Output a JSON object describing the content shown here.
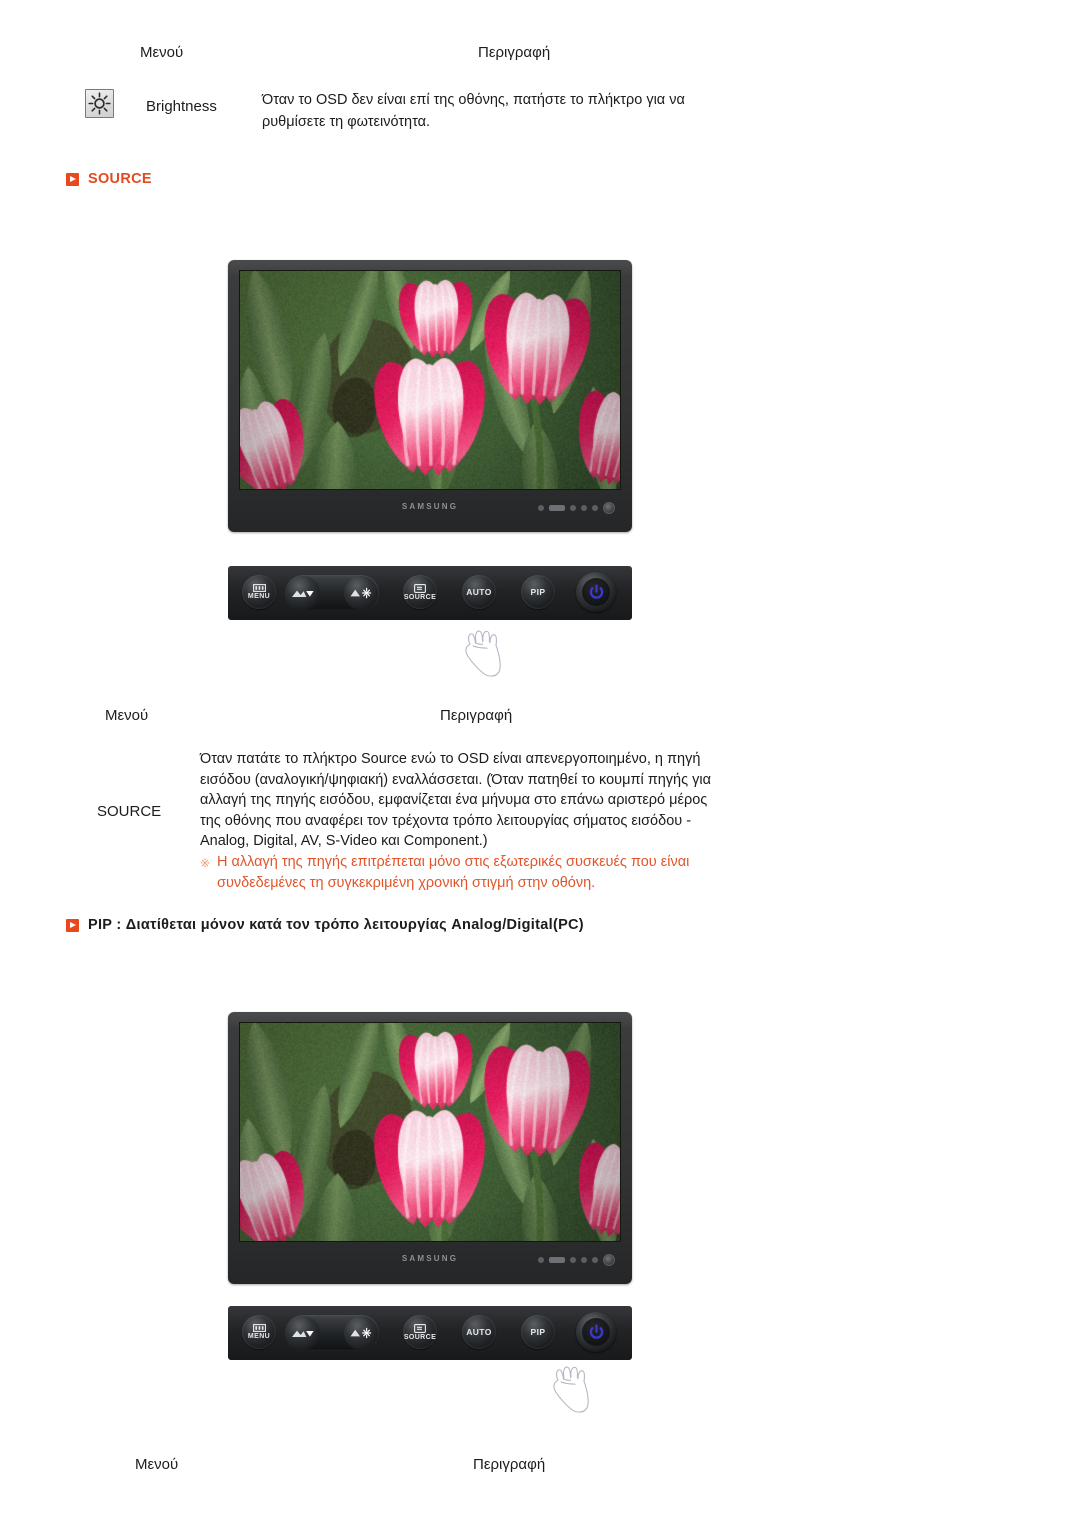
{
  "table_headers": {
    "menu": "Μενού",
    "description": "Περιγραφή"
  },
  "brightness_row": {
    "icon": "brightness-sun-icon",
    "label": "Brightness",
    "description": "Όταν το OSD δεν είναι επί της οθόνης, πατήστε το πλήκτρο για να ρυθμίσετε τη φωτεινότητα."
  },
  "sections": [
    {
      "id": "source",
      "heading": "SOURCE",
      "heading_color": "#e34a20",
      "bullet_color": "#e8481c"
    },
    {
      "id": "pip",
      "heading": "PIP : Διατίθεται μόνον κατά τον τρόπο λειτουργίας Analog/Digital(PC)",
      "heading_color": "#1c1c1c",
      "bullet_color": "#e8481c"
    }
  ],
  "monitor": {
    "brand": "SAMSUNG",
    "screen_content": "tulips-photo"
  },
  "control_panel": {
    "buttons": [
      {
        "name": "menu-button",
        "label": "MENU",
        "icon": "menu-bars-icon"
      },
      {
        "name": "down-button",
        "label": "",
        "icon": "volume-down-arrow-icon"
      },
      {
        "name": "up-button",
        "label": "",
        "icon": "brightness-up-arrow-icon"
      },
      {
        "name": "source-button",
        "label": "SOURCE",
        "icon": "source-input-icon"
      },
      {
        "name": "auto-button",
        "label": "AUTO",
        "icon": ""
      },
      {
        "name": "pip-button",
        "label": "PIP",
        "icon": ""
      },
      {
        "name": "power-button",
        "label": "",
        "icon": "power-icon"
      }
    ],
    "power_color": "#3a3ad0"
  },
  "source_row": {
    "label": "SOURCE",
    "description": "Όταν πατάτε το πλήκτρο Source ενώ το OSD είναι απενεργοποιημένο, η πηγή εισόδου (αναλογική/ψηφιακή) εναλλάσσεται. (Όταν πατηθεί το κουμπί πηγής για αλλαγή της πηγής εισόδου, εμφανίζεται ένα μήνυμα στο επάνω αριστερό μέρος της οθόνης που αναφέρει τον τρέχοντα τρόπο λειτουργίας σήματος εισόδου - Analog, Digital, AV, S-Video και Component.)",
    "note_marker": "※",
    "note": "Η αλλαγή της πηγής επιτρέπεται μόνο στις εξωτερικές συσκευές που είναι συνδεδεμένες τη συγκεκριμένη χρονική στιγμή στην οθόνη.",
    "note_color": "#e2552a"
  }
}
